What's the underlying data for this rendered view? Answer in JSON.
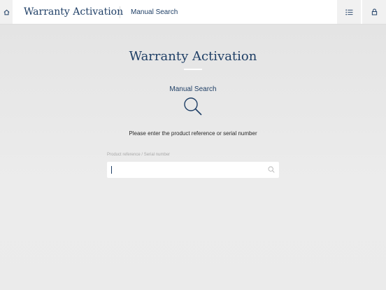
{
  "header": {
    "home_icon": "home-icon",
    "app_title": "Warranty Activation",
    "breadcrumb": "Manual Search",
    "list_icon": "list-icon",
    "lock_icon": "lock-icon"
  },
  "main": {
    "title": "Warranty Activation",
    "section_label": "Manual Search",
    "section_icon": "search-icon",
    "instruction": "Please enter the product reference or serial number",
    "field": {
      "label": "Product reference / Serial number",
      "value": "",
      "icon": "search-icon"
    }
  },
  "colors": {
    "accent": "#1f3f66",
    "background": "#e9e9e9",
    "header_background": "#ffffff"
  }
}
